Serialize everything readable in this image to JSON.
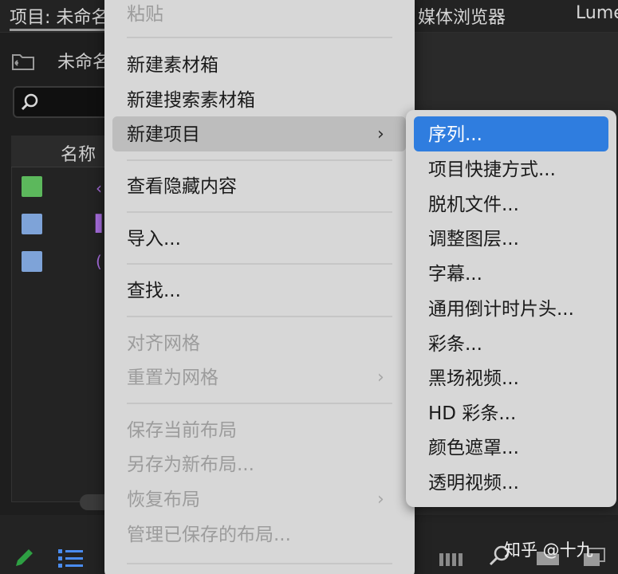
{
  "app": {
    "panel_tabs": {
      "project": "项目: 未命名",
      "media_browser": "媒体浏览器",
      "lumetri": "Lume"
    },
    "project_name": "未命名",
    "list_header_name": "名称",
    "rows": [
      {
        "color": "#5cb85c",
        "glyph": "‹"
      },
      {
        "color": "#7ea3d8",
        "glyph": "▌"
      },
      {
        "color": "#7ea3d8",
        "glyph": "("
      }
    ]
  },
  "context_menu": {
    "items": [
      {
        "label": "粘贴",
        "enabled": false
      },
      {
        "label": "新建素材箱",
        "enabled": true
      },
      {
        "label": "新建搜索素材箱",
        "enabled": true
      },
      {
        "label": "新建项目",
        "enabled": true,
        "submenu": true,
        "highlighted": true
      },
      {
        "label": "查看隐藏内容",
        "enabled": true
      },
      {
        "label": "导入...",
        "enabled": true
      },
      {
        "label": "查找...",
        "enabled": true
      },
      {
        "label": "对齐网格",
        "enabled": false
      },
      {
        "label": "重置为网格",
        "enabled": false,
        "submenu": true
      },
      {
        "label": "保存当前布局",
        "enabled": false
      },
      {
        "label": "另存为新布局...",
        "enabled": false
      },
      {
        "label": "恢复布局",
        "enabled": false,
        "submenu": true
      },
      {
        "label": "管理已保存的布局...",
        "enabled": false
      }
    ]
  },
  "submenu": {
    "items": [
      {
        "label": "序列...",
        "active": true
      },
      {
        "label": "项目快捷方式..."
      },
      {
        "label": "脱机文件..."
      },
      {
        "label": "调整图层..."
      },
      {
        "label": "字幕..."
      },
      {
        "label": "通用倒计时片头..."
      },
      {
        "label": "彩条..."
      },
      {
        "label": "黑场视频..."
      },
      {
        "label": "HD 彩条..."
      },
      {
        "label": "颜色遮罩..."
      },
      {
        "label": "透明视频..."
      }
    ]
  },
  "watermark": "知乎 @十九",
  "colors": {
    "highlight_blue": "#2f7ddf",
    "menu_bg": "#d7d7d7",
    "app_bg": "#1c1c1c"
  }
}
